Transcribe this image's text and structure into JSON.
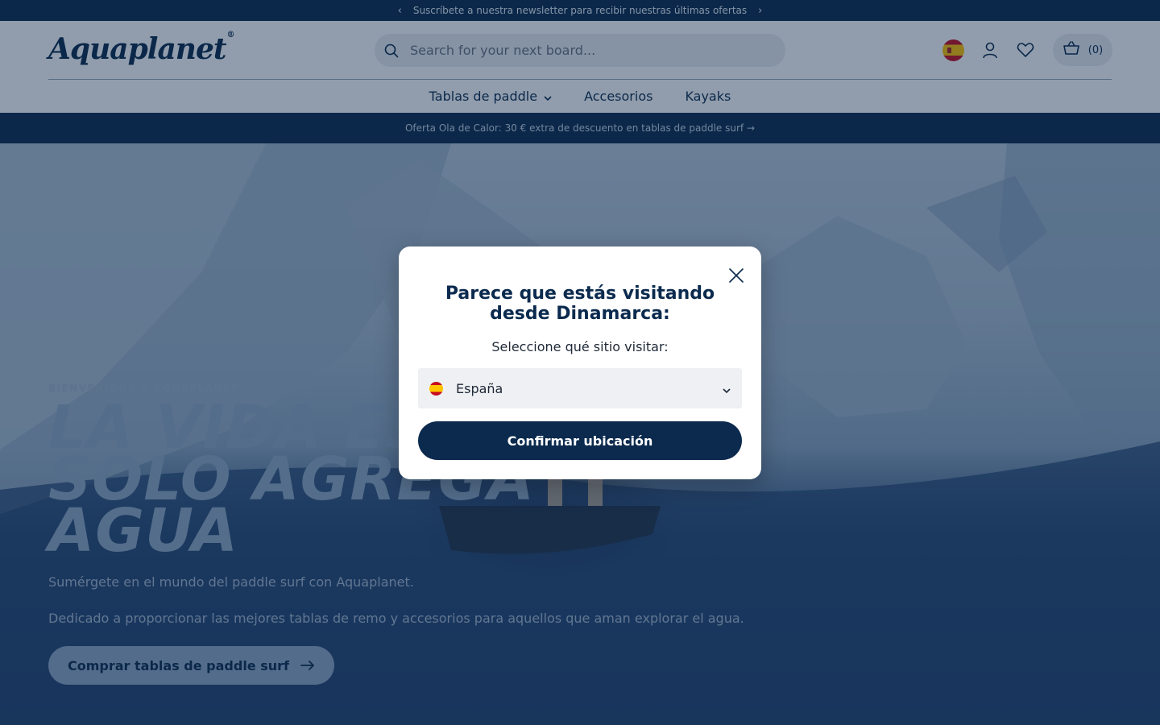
{
  "announcement": {
    "text": "Suscríbete a nuestra newsletter para recibir nuestras últimas ofertas",
    "prev_icon": "chevron-left-icon",
    "next_icon": "chevron-right-icon"
  },
  "header": {
    "logo": "Aquaplanet",
    "logo_mark": "®",
    "search_placeholder": "Search for your next board...",
    "cart_count": "(0)"
  },
  "nav": {
    "items": [
      {
        "label": "Tablas de paddle",
        "has_dropdown": true
      },
      {
        "label": "Accesorios"
      },
      {
        "label": "Kayaks"
      }
    ]
  },
  "promo": {
    "text": "Oferta Ola de Calor: 30 € extra de descuento en tablas de paddle surf →"
  },
  "hero": {
    "kicker": "BIENVENIDOS A AQUAPLANET",
    "headline_lines": [
      "LA VIDA ES",
      "SOLO AGREGA",
      "AGUA"
    ],
    "subtitle": "Sumérgete en el mundo del paddle surf con Aquaplanet.",
    "description": "Dedicado a proporcionar las mejores tablas de remo y accesorios para aquellos que aman explorar el agua.",
    "cta": "Comprar tablas de paddle surf"
  },
  "modal": {
    "title_line1": "Parece que estás visitando",
    "title_line2": "desde Dinamarca:",
    "label": "Seleccione qué sitio visitar:",
    "selected_site": "España",
    "confirm": "Confirmar ubicación"
  },
  "colors": {
    "navy": "#0b2a4e",
    "overlay": "rgba(12,37,72,0.45)"
  }
}
